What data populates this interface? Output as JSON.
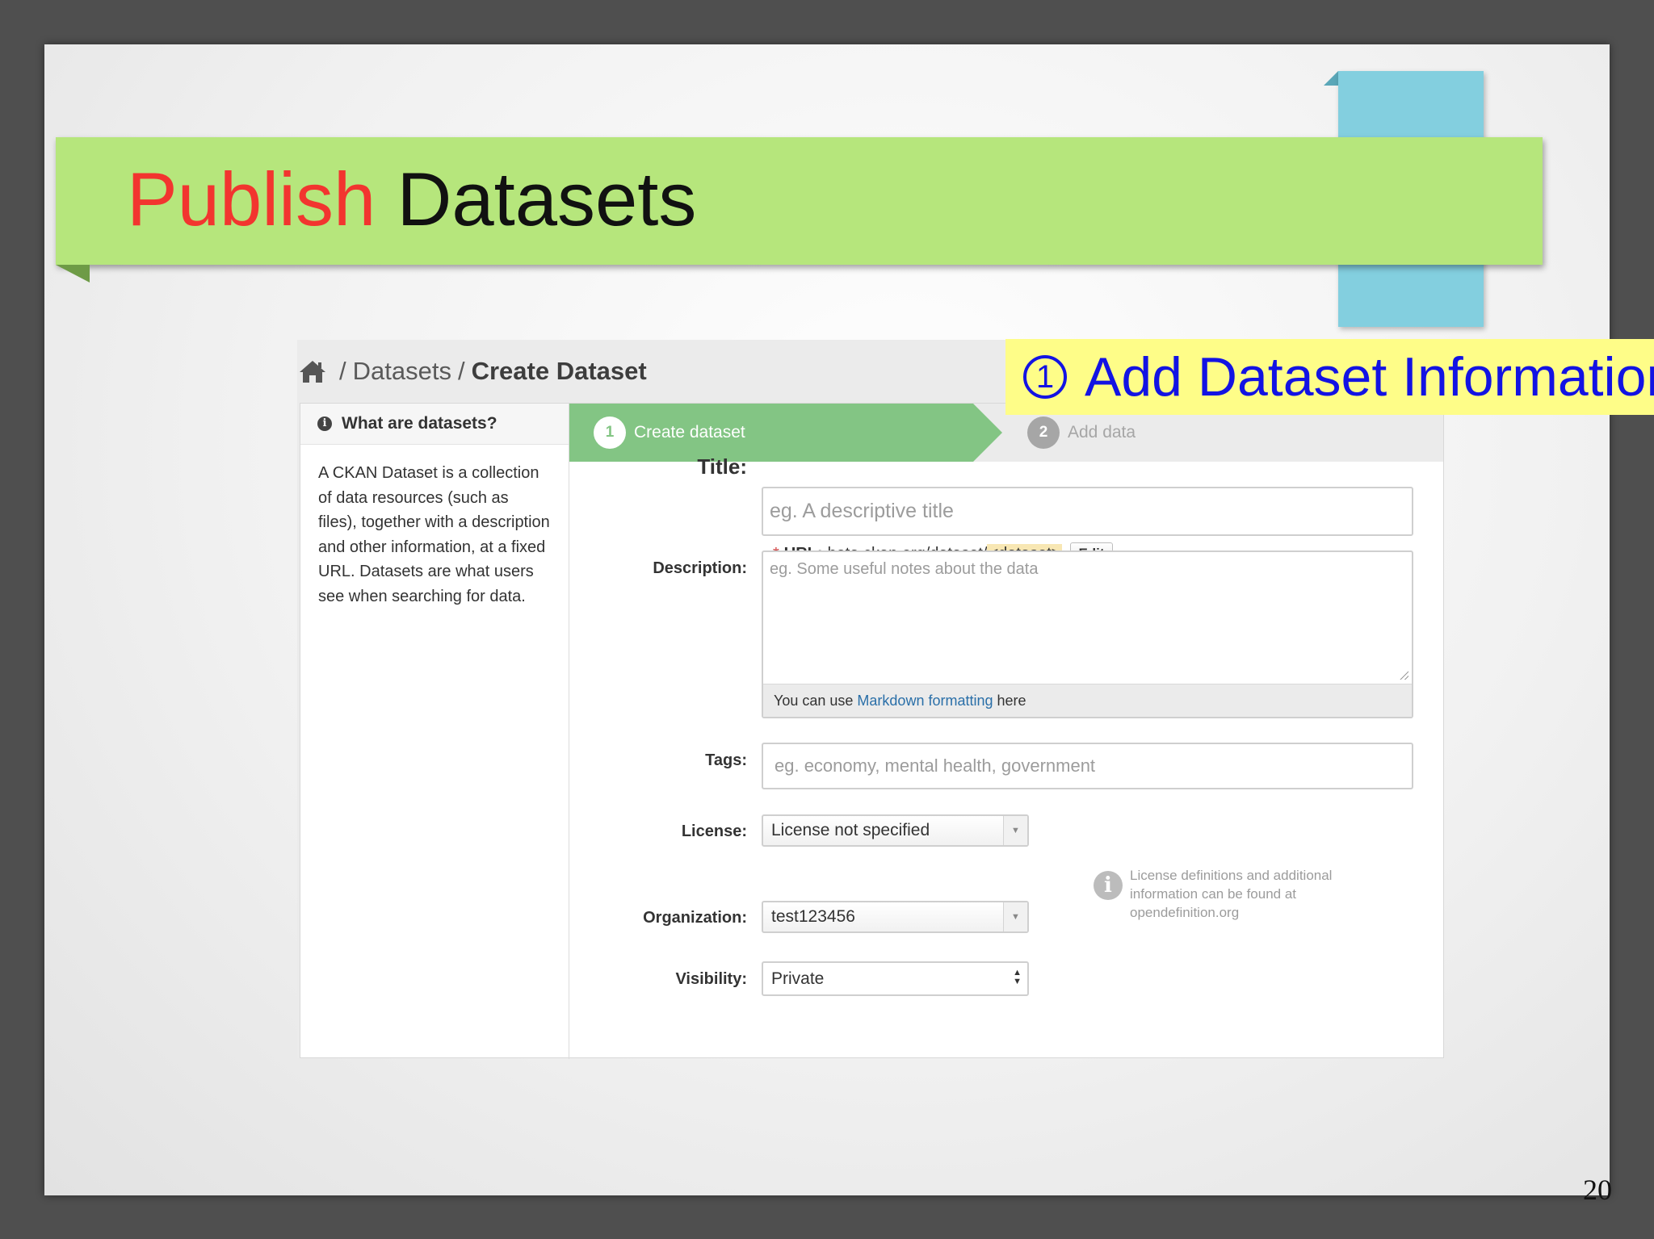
{
  "slide": {
    "title_accent": "Publish",
    "title_main": "Datasets",
    "page_number": "20",
    "callout_number": "1",
    "callout_text": "Add Dataset Information"
  },
  "breadcrumb": {
    "home_icon": "home-icon",
    "separator": "/",
    "datasets": "Datasets",
    "current": "Create Dataset"
  },
  "sidebar": {
    "icon": "info-icon",
    "heading": "What are datasets?",
    "body": "A CKAN Dataset is a collection of data resources (such as files), together with a description and other information, at a fixed URL. Datasets are what users see when searching for data."
  },
  "steps": [
    {
      "number": "1",
      "label": "Create dataset",
      "active": true
    },
    {
      "number": "2",
      "label": "Add data",
      "active": false
    }
  ],
  "form": {
    "title_label": "Title:",
    "title_placeholder": "eg. A descriptive title",
    "url_required_mark": "*",
    "url_label": "URL:",
    "url_base": "beta.ckan.org/dataset/",
    "url_slug": "<dataset>",
    "url_edit_button": "Edit",
    "description_label": "Description:",
    "description_placeholder": "eg. Some useful notes about the data",
    "markdown_prefix": "You can use",
    "markdown_link": "Markdown formatting",
    "markdown_suffix": "here",
    "tags_label": "Tags:",
    "tags_placeholder": "eg. economy, mental health, government",
    "license_label": "License:",
    "license_value": "License not specified",
    "license_info_text": "License definitions and additional information can be found at",
    "license_info_link": "opendefinition.org",
    "organization_label": "Organization:",
    "organization_value": "test123456",
    "visibility_label": "Visibility:",
    "visibility_value": "Private"
  },
  "colors": {
    "title_band": "#b6e67c",
    "title_accent": "#f2352f",
    "blue_tab": "#83cfdf",
    "callout_bg": "#fefd88",
    "callout_text": "#1313e3",
    "active_step": "#83c584"
  }
}
